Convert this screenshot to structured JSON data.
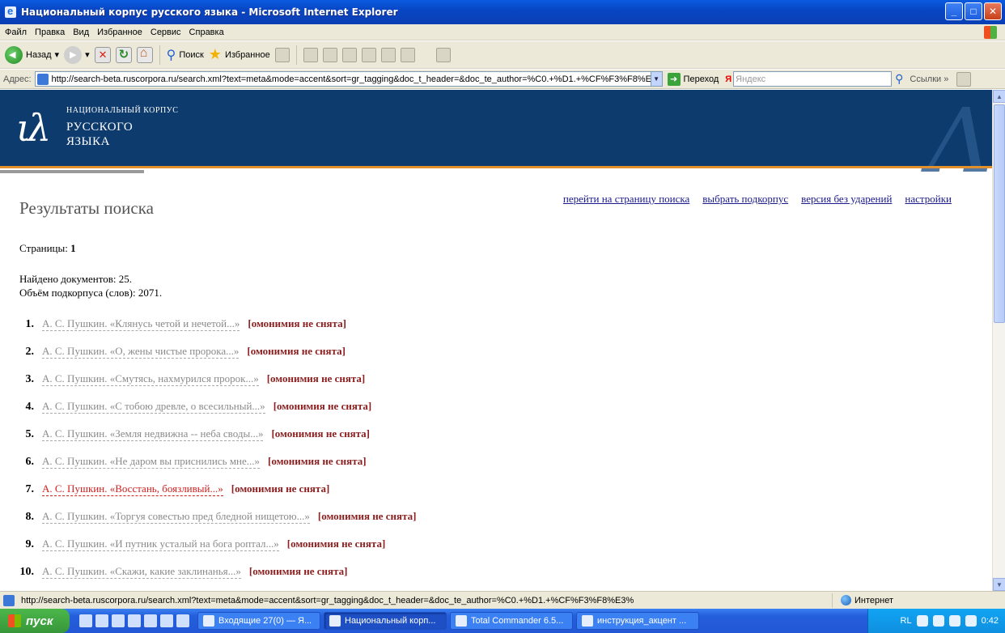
{
  "window": {
    "title": "Национальный корпус русского языка - Microsoft Internet Explorer"
  },
  "menu": [
    "Файл",
    "Правка",
    "Вид",
    "Избранное",
    "Сервис",
    "Справка"
  ],
  "toolbar": {
    "back": "Назад",
    "search": "Поиск",
    "favorites": "Избранное"
  },
  "address": {
    "label": "Адрес:",
    "url": "http://search-beta.ruscorpora.ru/search.xml?text=meta&mode=accent&sort=gr_tagging&doc_t_header=&doc_te_author=%C0.+%D1.+%CF%F3%F8%E",
    "go": "Переход",
    "yandex_placeholder": "Яндекс",
    "links": "Ссылки"
  },
  "site": {
    "logo_line1": "НАЦИОНАЛЬНЫЙ КОРПУС",
    "logo_line2": "РУССКОГО",
    "logo_line3": "ЯЗЫКА"
  },
  "page": {
    "title": "Результаты поиска",
    "top_links": [
      "перейти на страницу поиска",
      "выбрать подкорпус",
      "версия без ударений",
      "настройки"
    ],
    "pages_label": "Страницы:",
    "pages_value": "1",
    "found_docs": "Найдено документов: 25.",
    "subcorpus_size": "Объём подкорпуса (слов): 2071."
  },
  "results": [
    {
      "num": "1.",
      "title": "А. С. Пушкин. «Клянусь четой и нечетой...»",
      "note": "[омонимия не снята]"
    },
    {
      "num": "2.",
      "title": "А. С. Пушкин. «О, жены чистые пророка...»",
      "note": "[омонимия не снята]"
    },
    {
      "num": "3.",
      "title": "А. С. Пушкин. «Смутясь, нахмурился пророк...»",
      "note": "[омонимия не снята]"
    },
    {
      "num": "4.",
      "title": "А. С. Пушкин. «С тобою древле, о всесильный...»",
      "note": "[омонимия не снята]"
    },
    {
      "num": "5.",
      "title": "А. С. Пушкин. «Земля недвижна -- неба своды...»",
      "note": "[омонимия не снята]"
    },
    {
      "num": "6.",
      "title": "А. С. Пушкин. «Не даром вы приснились мне...»",
      "note": "[омонимия не снята]"
    },
    {
      "num": "7.",
      "title": "А. С. Пушкин. «Восстань, боязливый...»",
      "note": "[омонимия не снята]"
    },
    {
      "num": "8.",
      "title": "А. С. Пушкин. «Торгуя совестью пред бледной нищетою...»",
      "note": "[омонимия не снята]"
    },
    {
      "num": "9.",
      "title": "А. С. Пушкин. «И путник усталый на бога роптал...»",
      "note": "[омонимия не снята]"
    },
    {
      "num": "10.",
      "title": "А. С. Пушкин. «Скажи, какие заклинанья...»",
      "note": "[омонимия не снята]"
    }
  ],
  "active_result_index": 6,
  "statusbar": {
    "url": "http://search-beta.ruscorpora.ru/search.xml?text=meta&mode=accent&sort=gr_tagging&doc_t_header=&doc_te_author=%C0.+%D1.+%CF%F3%F8%E3%",
    "zone": "Интернет"
  },
  "taskbar": {
    "start": "пуск",
    "tasks": [
      "Входящие 27(0) — Я...",
      "Национальный корп...",
      "Total Commander 6.5...",
      "инструкция_акцент ..."
    ],
    "active_task": 1,
    "clock": "0:42",
    "lang": "RL"
  },
  "colors": {
    "header_bg": "#0e3b6d",
    "accent_orange": "#e38f2c",
    "active_link": "#d02020",
    "homonymy_note": "#8b1e1e"
  }
}
